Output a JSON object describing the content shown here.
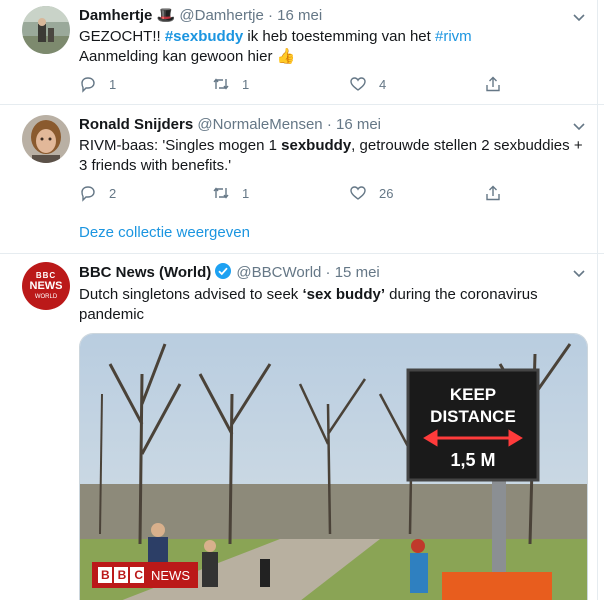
{
  "tweets": [
    {
      "name": "Damhertje",
      "name_emoji": "🎩",
      "handle": "@Damhertje",
      "dot": "·",
      "date": "16 mei",
      "text_parts": [
        "GEZOCHT!! ",
        "#sexbuddy",
        " ik heb toestemming van het ",
        "#rivm",
        " Aanmelding kan gewoon hier "
      ],
      "text_emoji": "👍",
      "replies": "1",
      "retweets": "1",
      "likes": "4"
    },
    {
      "name": "Ronald Snijders",
      "handle": "@NormaleMensen",
      "dot": "·",
      "date": "16 mei",
      "text_parts": [
        "RIVM-baas: 'Singles mogen 1 ",
        "sexbuddy",
        ", getrouwde stellen 2 sexbuddies + 3 friends with benefits.'"
      ],
      "replies": "2",
      "retweets": "1",
      "likes": "26",
      "collection_link": "Deze collectie weergeven"
    },
    {
      "name": "BBC News (World)",
      "handle": "@BBCWorld",
      "dot": "·",
      "date": "15 mei",
      "avatar_lines": [
        "BBC",
        "NEWS",
        "WORLD"
      ],
      "text_parts": [
        "Dutch singletons advised to seek ",
        "‘sex buddy’",
        " during the coronavirus pandemic"
      ],
      "media": {
        "sign_line1": "KEEP",
        "sign_line2": "DISTANCE",
        "sign_distance": "1,5 M",
        "watermark_bbc": "BBC",
        "watermark_news": "NEWS"
      }
    }
  ],
  "colors": {
    "accent": "#1b95e0",
    "muted": "#657786",
    "border": "#e6ecf0",
    "bbc_red": "#bb1919"
  }
}
